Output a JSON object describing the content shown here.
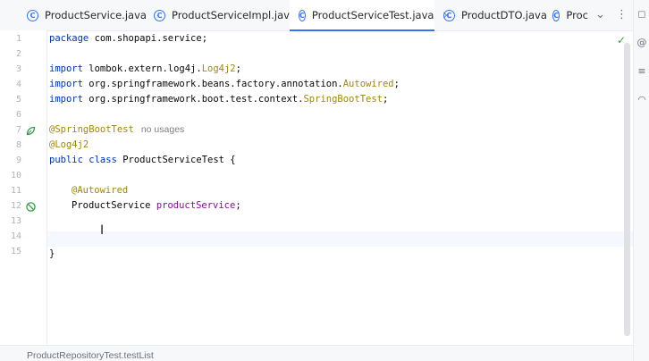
{
  "tabs": [
    {
      "label": "ProductService.java"
    },
    {
      "label": "ProductServiceImpl.java"
    },
    {
      "label": "ProductServiceTest.java",
      "active": true
    },
    {
      "label": "ProductDTO.java"
    },
    {
      "label": "Proc"
    }
  ],
  "tab_icon_glyph": "C",
  "close_glyph": "×",
  "line_numbers": [
    "1",
    "2",
    "3",
    "4",
    "5",
    "6",
    "7",
    "8",
    "9",
    "10",
    "11",
    "12",
    "13",
    "14",
    "15"
  ],
  "code": {
    "l1_kw": "package",
    "l1_rest": " com.shopapi.service;",
    "l3_kw": "import",
    "l3_rest": " lombok.extern.log4j.",
    "l3_ann": "Log4j2",
    "l3_end": ";",
    "l4_kw": "import",
    "l4_rest": " org.springframework.beans.factory.annotation.",
    "l4_ann": "Autowired",
    "l4_end": ";",
    "l5_kw": "import",
    "l5_rest": " org.springframework.boot.test.context.",
    "l5_ann": "SpringBootTest",
    "l5_end": ";",
    "l7_ann": "@SpringBootTest",
    "l7_hint": "no usages",
    "l8_ann": "@Log4j2",
    "l9_kw1": "public",
    "l9_kw2": "class",
    "l9_rest": " ProductServiceTest {",
    "l11_ann": "@Autowired",
    "l12_type": "ProductService ",
    "l12_field": "productService",
    "l12_end": ";",
    "l15": "}"
  },
  "statusbar": {
    "text": "ProductRepositoryTest.testList"
  },
  "colors": {
    "accent": "#3574f0",
    "keyword": "#0033b3",
    "annotation": "#9e880d",
    "field": "#871094"
  }
}
